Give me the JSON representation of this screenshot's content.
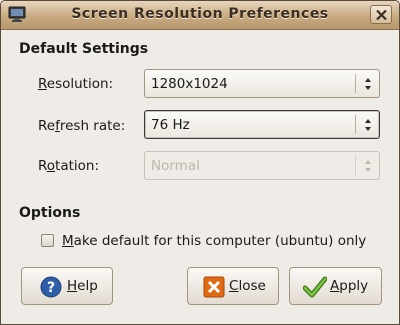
{
  "window": {
    "title": "Screen Resolution Preferences"
  },
  "settings": {
    "heading": "Default Settings",
    "resolution": {
      "label_u": "R",
      "label_rest": "esolution:",
      "value": "1280x1024"
    },
    "refresh": {
      "label_pre": "Re",
      "label_u": "f",
      "label_rest": "resh rate:",
      "value": "76 Hz"
    },
    "rotation": {
      "label_pre": "R",
      "label_u": "o",
      "label_rest": "tation:",
      "value": "Normal"
    }
  },
  "options": {
    "heading": "Options",
    "make_default": {
      "label_u": "M",
      "label_rest": "ake default for this computer (ubuntu) only",
      "checked": false
    }
  },
  "buttons": {
    "help": {
      "label_u": "H",
      "label_rest": "elp"
    },
    "close": {
      "label_u": "C",
      "label_rest": "lose"
    },
    "apply": {
      "label_u": "A",
      "label_rest": "pply"
    }
  },
  "colors": {
    "titlebar": "#c9ab82",
    "help_icon": "#2e5ea8",
    "close_icon": "#e06a14",
    "apply_icon": "#5aa02a"
  }
}
